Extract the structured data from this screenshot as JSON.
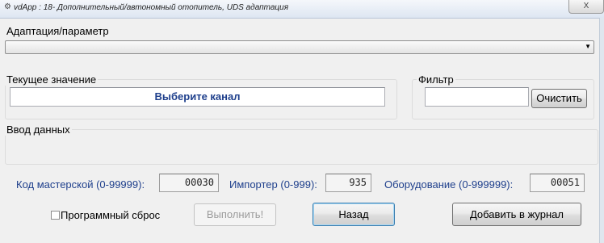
{
  "window": {
    "title": "vdApp : 18- Дополнительный/автономный отопитель,  UDS адаптация",
    "close_label": "X",
    "app_icon": "app-icon"
  },
  "adaptation": {
    "label": "Адаптация/параметр",
    "selected": ""
  },
  "current_value": {
    "label": "Текущее значение",
    "display": "Выберите канал"
  },
  "filter": {
    "label": "Фильтр",
    "value": "",
    "clear_button": "Очистить"
  },
  "data_input": {
    "label": "Ввод данных"
  },
  "codes": {
    "workshop_label": "Код мастерской (0-99999):",
    "workshop_value": "00030",
    "importer_label": "Импортер (0-999):",
    "importer_value": "935",
    "equipment_label": "Оборудование (0-999999):",
    "equipment_value": "00051"
  },
  "actions": {
    "soft_reset_label": "Программный сброс",
    "soft_reset_checked": false,
    "execute_button": "Выполнить!",
    "back_button": "Назад",
    "add_log_button": "Добавить в журнал"
  },
  "colors": {
    "label_blue": "#1e3f8c",
    "default_button_border": "#3c7fb1"
  }
}
